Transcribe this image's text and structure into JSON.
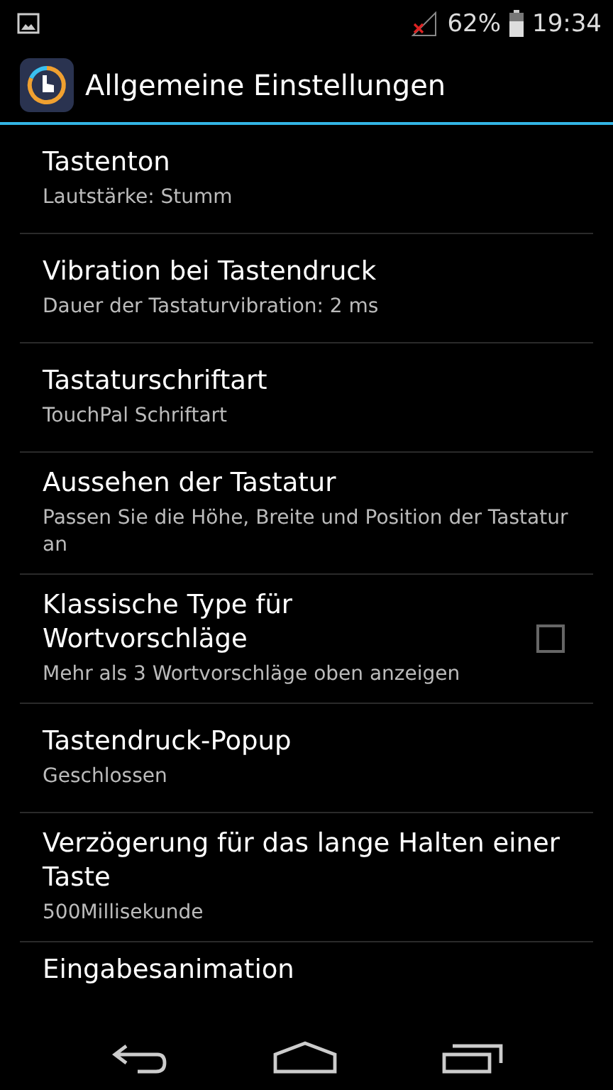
{
  "status_bar": {
    "battery_text": "62%",
    "time": "19:34"
  },
  "action_bar": {
    "title": "Allgemeine Einstellungen"
  },
  "settings": [
    {
      "kind": "text",
      "title": "Tastenton",
      "summary": "Lautstärke: Stumm"
    },
    {
      "kind": "text",
      "title": "Vibration bei Tastendruck",
      "summary": "Dauer der Tastaturvibration:  2 ms"
    },
    {
      "kind": "text",
      "title": "Tastaturschriftart",
      "summary": "TouchPal Schriftart"
    },
    {
      "kind": "text",
      "title": "Aussehen der Tastatur",
      "summary": "Passen Sie die Höhe, Breite und Position der Tastatur an"
    },
    {
      "kind": "checkbox",
      "title": "Klassische Type für Wortvorschläge",
      "summary": "Mehr als 3 Wortvorschläge oben anzeigen",
      "checked": false
    },
    {
      "kind": "text",
      "title": "Tastendruck-Popup",
      "summary": "Geschlossen"
    },
    {
      "kind": "text",
      "title": "Verzögerung für das lange Halten einer Taste",
      "summary": "500Millisekunde"
    },
    {
      "kind": "text",
      "title": "Eingabesanimation"
    }
  ]
}
